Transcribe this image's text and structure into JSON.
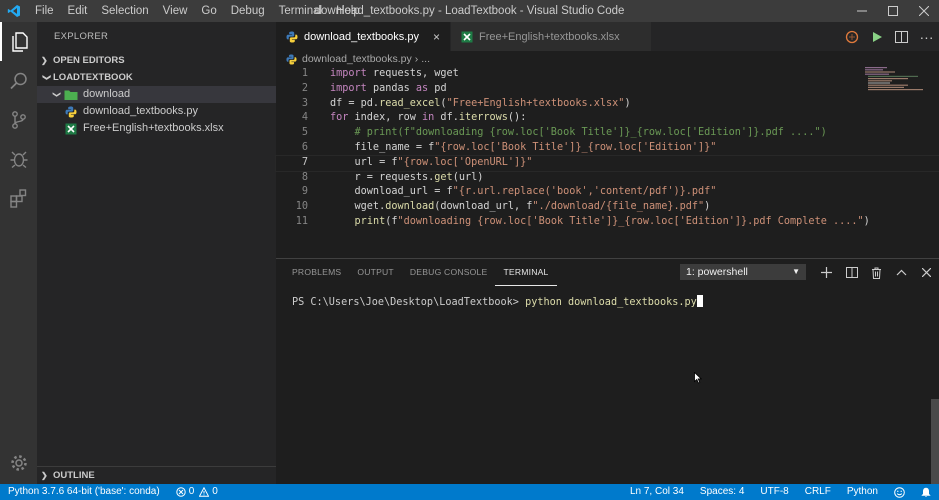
{
  "window": {
    "title": "download_textbooks.py - LoadTextbook - Visual Studio Code",
    "menu": [
      "File",
      "Edit",
      "Selection",
      "View",
      "Go",
      "Debug",
      "Terminal",
      "Help"
    ]
  },
  "sidebar": {
    "title": "EXPLORER",
    "sections": {
      "open_editors": "OPEN EDITORS",
      "project": "LOADTEXTBOOK",
      "outline": "OUTLINE"
    },
    "tree": [
      {
        "label": "download",
        "type": "folder"
      },
      {
        "label": "download_textbooks.py",
        "type": "python"
      },
      {
        "label": "Free+English+textbooks.xlsx",
        "type": "excel"
      }
    ]
  },
  "editor": {
    "tabs": [
      {
        "label": "download_textbooks.py",
        "active": true
      },
      {
        "label": "Free+English+textbooks.xlsx",
        "active": false
      }
    ],
    "breadcrumb": [
      "download_textbooks.py",
      "..."
    ],
    "current_line": 7,
    "lines": [
      {
        "n": "1",
        "tokens": [
          {
            "t": "import",
            "c": "kw"
          },
          {
            "t": " requests, wget",
            "c": ""
          }
        ]
      },
      {
        "n": "2",
        "tokens": [
          {
            "t": "import",
            "c": "kw"
          },
          {
            "t": " pandas ",
            "c": ""
          },
          {
            "t": "as",
            "c": "kw"
          },
          {
            "t": " pd",
            "c": ""
          }
        ]
      },
      {
        "n": "3",
        "tokens": [
          {
            "t": "df = pd.",
            "c": ""
          },
          {
            "t": "read_excel",
            "c": "fn"
          },
          {
            "t": "(",
            "c": ""
          },
          {
            "t": "\"Free+English+textbooks.xlsx\"",
            "c": "str"
          },
          {
            "t": ")",
            "c": ""
          }
        ]
      },
      {
        "n": "4",
        "tokens": [
          {
            "t": "for",
            "c": "kw"
          },
          {
            "t": " index, row ",
            "c": ""
          },
          {
            "t": "in",
            "c": "kw"
          },
          {
            "t": " df.",
            "c": ""
          },
          {
            "t": "iterrows",
            "c": "fn"
          },
          {
            "t": "():",
            "c": ""
          }
        ]
      },
      {
        "n": "5",
        "tokens": [
          {
            "t": "    # print(f\"downloading {row.loc['Book Title']}_{row.loc['Edition']}.pdf ....\")",
            "c": "cm"
          }
        ]
      },
      {
        "n": "6",
        "tokens": [
          {
            "t": "    file_name = f",
            "c": ""
          },
          {
            "t": "\"",
            "c": "str"
          },
          {
            "t": "{row.loc['Book Title']}_{row.loc['Edition']}",
            "c": "str"
          },
          {
            "t": "\"",
            "c": "str"
          }
        ]
      },
      {
        "n": "7",
        "tokens": [
          {
            "t": "    url = f",
            "c": ""
          },
          {
            "t": "\"{row.loc['OpenURL']}\"",
            "c": "str"
          }
        ]
      },
      {
        "n": "8",
        "tokens": [
          {
            "t": "    r = requests.",
            "c": ""
          },
          {
            "t": "get",
            "c": "fn"
          },
          {
            "t": "(url)",
            "c": ""
          }
        ]
      },
      {
        "n": "9",
        "tokens": [
          {
            "t": "    download_url = f",
            "c": ""
          },
          {
            "t": "\"{r.url.replace('book','content/pdf')}.pdf\"",
            "c": "str"
          }
        ]
      },
      {
        "n": "10",
        "tokens": [
          {
            "t": "    wget.",
            "c": ""
          },
          {
            "t": "download",
            "c": "fn"
          },
          {
            "t": "(download_url, f",
            "c": ""
          },
          {
            "t": "\"./download/{file_name}.pdf\"",
            "c": "str"
          },
          {
            "t": ")",
            "c": ""
          }
        ]
      },
      {
        "n": "11",
        "tokens": [
          {
            "t": "    ",
            "c": ""
          },
          {
            "t": "print",
            "c": "fn"
          },
          {
            "t": "(f",
            "c": ""
          },
          {
            "t": "\"downloading {row.loc['Book Title']}_{row.loc['Edition']}.pdf Complete ....\"",
            "c": "str"
          },
          {
            "t": ")",
            "c": ""
          }
        ]
      }
    ]
  },
  "panel": {
    "tabs": [
      "PROBLEMS",
      "OUTPUT",
      "DEBUG CONSOLE",
      "TERMINAL"
    ],
    "active_tab": "TERMINAL",
    "terminal_select": "1: powershell",
    "prompt": "PS C:\\Users\\Joe\\Desktop\\LoadTextbook> ",
    "command": "python download_textbooks.py"
  },
  "statusbar": {
    "interpreter": "Python 3.7.6 64-bit ('base': conda)",
    "errors": "0",
    "warnings": "0",
    "position": "Ln 7, Col 34",
    "spaces": "Spaces: 4",
    "encoding": "UTF-8",
    "eol": "CRLF",
    "language": "Python"
  },
  "colors": {
    "accent": "#007acc",
    "keyword": "#c586c0",
    "string": "#ce9178",
    "function": "#dcdcaa",
    "comment": "#6a9955"
  },
  "icons": [
    "vscode-logo-icon",
    "files-icon",
    "search-icon",
    "source-control-icon",
    "debug-icon",
    "extensions-icon",
    "gear-icon",
    "run-icon",
    "split-editor-icon",
    "more-icon",
    "python-file-icon",
    "excel-file-icon",
    "folder-icon",
    "trash-icon",
    "plus-icon",
    "bell-icon",
    "feedback-icon"
  ]
}
